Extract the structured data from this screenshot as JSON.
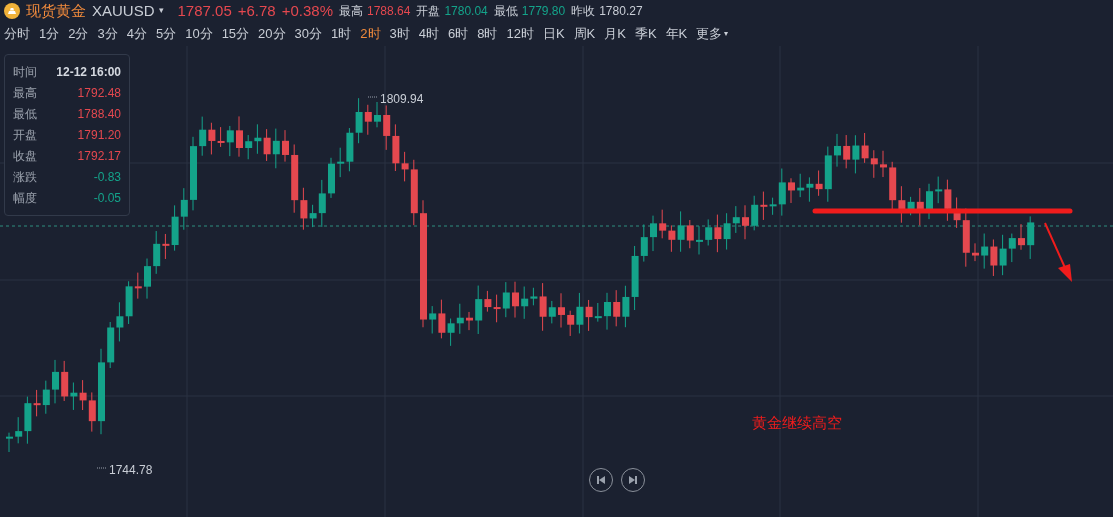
{
  "header": {
    "name": "现货黄金",
    "symbol": "XAUUSD",
    "dropdown": "▾",
    "price": "1787.05",
    "change": "+6.78",
    "change_pct": "+0.38%",
    "stats": [
      {
        "label": "最高",
        "value": "1788.64",
        "color": "#e5484f"
      },
      {
        "label": "开盘",
        "value": "1780.04",
        "color": "#14a38a"
      },
      {
        "label": "最低",
        "value": "1779.80",
        "color": "#14a38a"
      },
      {
        "label": "昨收",
        "value": "1780.27",
        "color": "#c9ced6"
      }
    ]
  },
  "periods": [
    {
      "label": "分时",
      "selected": false
    },
    {
      "label": "1分",
      "selected": false
    },
    {
      "label": "2分",
      "selected": false
    },
    {
      "label": "3分",
      "selected": false
    },
    {
      "label": "4分",
      "selected": false
    },
    {
      "label": "5分",
      "selected": false
    },
    {
      "label": "10分",
      "selected": false
    },
    {
      "label": "15分",
      "selected": false
    },
    {
      "label": "20分",
      "selected": false
    },
    {
      "label": "30分",
      "selected": false
    },
    {
      "label": "1时",
      "selected": false
    },
    {
      "label": "2时",
      "selected": true
    },
    {
      "label": "3时",
      "selected": false
    },
    {
      "label": "4时",
      "selected": false
    },
    {
      "label": "6时",
      "selected": false
    },
    {
      "label": "8时",
      "selected": false
    },
    {
      "label": "12时",
      "selected": false
    },
    {
      "label": "日K",
      "selected": false
    },
    {
      "label": "周K",
      "selected": false
    },
    {
      "label": "月K",
      "selected": false
    },
    {
      "label": "季K",
      "selected": false
    },
    {
      "label": "年K",
      "selected": false
    }
  ],
  "more": "更多",
  "more_caret": "▾",
  "info": {
    "time_label": "时间",
    "time": "12-12 16:00",
    "rows": [
      {
        "label": "最高",
        "value": "1792.48",
        "color": "#e5484f"
      },
      {
        "label": "最低",
        "value": "1788.40",
        "color": "#e5484f"
      },
      {
        "label": "开盘",
        "value": "1791.20",
        "color": "#e5484f"
      },
      {
        "label": "收盘",
        "value": "1792.17",
        "color": "#e5484f"
      },
      {
        "label": "涨跌",
        "value": "-0.83",
        "color": "#14a38a"
      },
      {
        "label": "幅度",
        "value": "-0.05",
        "color": "#14a38a"
      }
    ]
  },
  "chart": {
    "high_label": "1809.94",
    "low_label": "1744.78",
    "annotation": "黄金继续高空"
  }
}
